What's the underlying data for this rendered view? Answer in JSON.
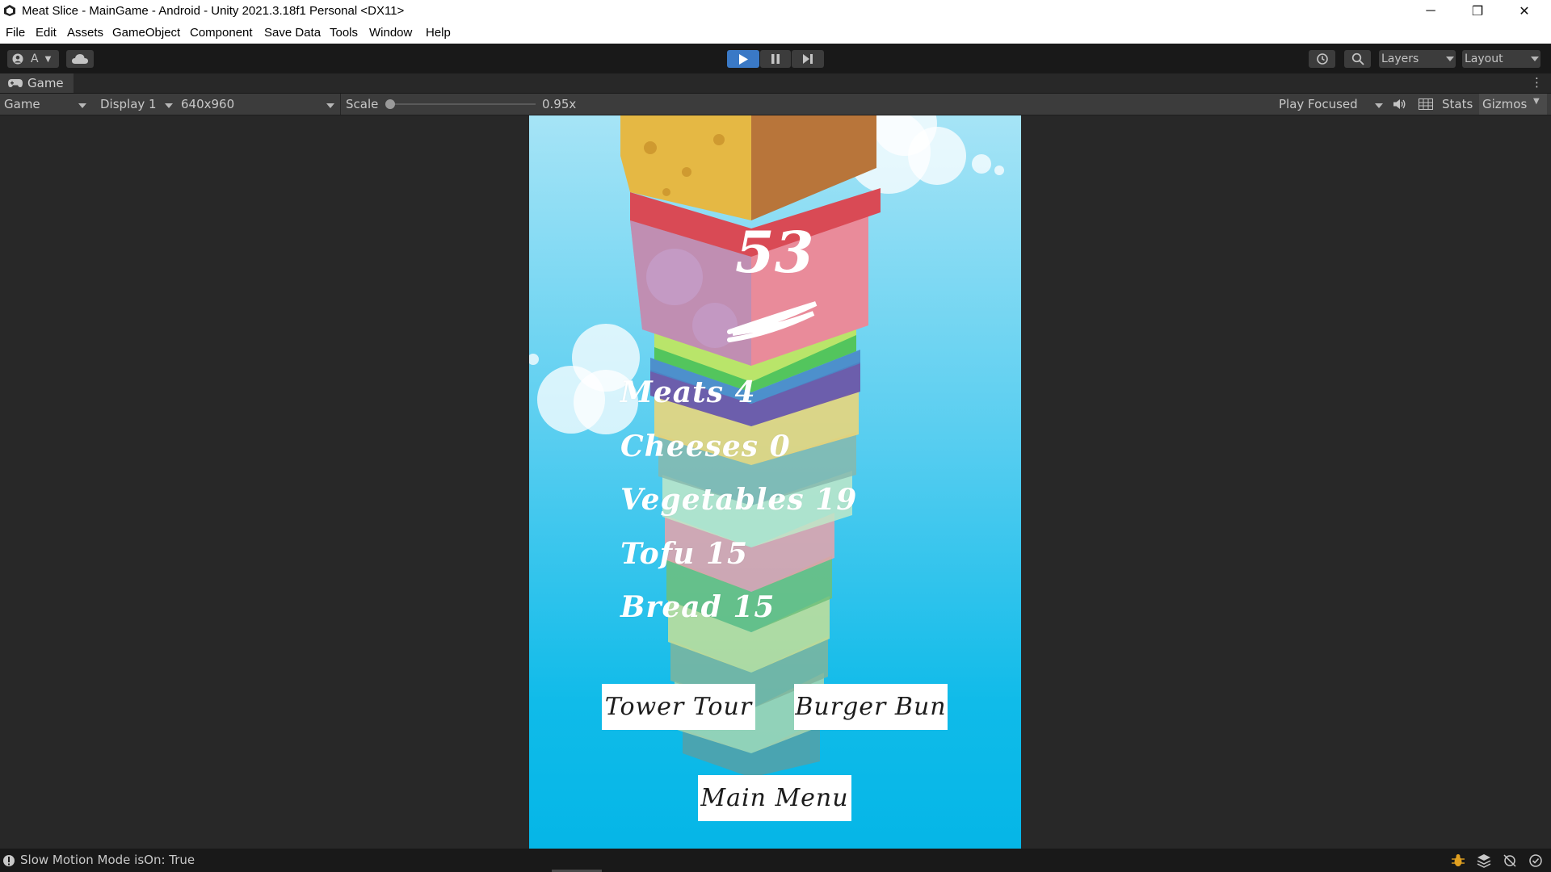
{
  "window": {
    "title": "Meat Slice - MainGame - Android - Unity 2021.3.18f1 Personal <DX11>",
    "minimize_glyph": "─",
    "restore_glyph": "❐",
    "close_glyph": "✕"
  },
  "menu": {
    "items": [
      "File",
      "Edit",
      "Assets",
      "GameObject",
      "Component",
      "Save Data",
      "Tools",
      "Window",
      "Help"
    ]
  },
  "toolbar": {
    "account_label": "A",
    "layers_label": "Layers",
    "layout_label": "Layout"
  },
  "game_tab": {
    "label": "Game"
  },
  "game_bar": {
    "view_mode": "Game",
    "display": "Display 1",
    "resolution": "640x960",
    "scale_label": "Scale",
    "scale_value": "0.95x",
    "play_mode": "Play Focused",
    "stats_label": "Stats",
    "gizmos_label": "Gizmos"
  },
  "game": {
    "score": "53",
    "stats": [
      {
        "label": "Meats",
        "value": "4"
      },
      {
        "label": "Cheeses",
        "value": "0"
      },
      {
        "label": "Vegetables",
        "value": "19"
      },
      {
        "label": "Tofu",
        "value": "15"
      },
      {
        "label": "Bread",
        "value": "15"
      }
    ],
    "buttons": {
      "tower_tour": "Tower Tour",
      "burger_bun": "Burger Bun",
      "main_menu": "Main Menu"
    }
  },
  "status": {
    "message": "Slow Motion Mode isOn: True"
  },
  "colors": {
    "accent_play": "#3a79c6",
    "sky_top": "#a6e4f6",
    "sky_bottom": "#05b6e7"
  }
}
